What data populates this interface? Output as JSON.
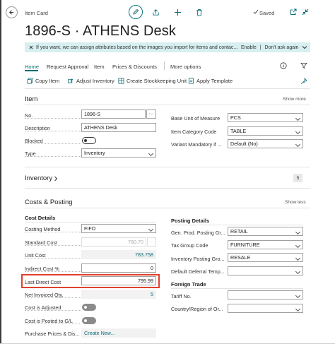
{
  "header": {
    "breadcrumb": "Item Card",
    "saved_label": "Saved",
    "title": "1896-S · ATHENS Desk"
  },
  "notification": {
    "message": "If you want, we can assign attributes based on the images you import for items and contac...",
    "enable_label": "Enable",
    "separator": "|",
    "dont_ask_label": "Don't ask again"
  },
  "tabs": {
    "home": "Home",
    "request_approval": "Request Approval",
    "item": "Item",
    "prices_discounts": "Prices & Discounts",
    "more_options": "More options"
  },
  "actions": {
    "copy_item": "Copy Item",
    "adjust_inventory": "Adjust Inventory",
    "create_sku": "Create Stockkeeping Unit",
    "apply_template": "Apply Template"
  },
  "item_section": {
    "title": "Item",
    "show_more": "Show more",
    "fields": {
      "no_label": "No.",
      "no_value": "1896-S",
      "description_label": "Description",
      "description_value": "ATHENS Desk",
      "blocked_label": "Blocked",
      "type_label": "Type",
      "type_value": "Inventory",
      "base_uom_label": "Base Unit of Measure",
      "base_uom_value": "PCS",
      "item_category_label": "Item Category Code",
      "item_category_value": "TABLE",
      "variant_mandatory_label": "Variant Mandatory if ...",
      "variant_mandatory_value": "Default (No)"
    }
  },
  "inventory_section": {
    "title": "Inventory",
    "badge": "5"
  },
  "costs_section": {
    "title": "Costs & Posting",
    "show_less": "Show less",
    "cost_details_heading": "Cost Details",
    "posting_details_heading": "Posting Details",
    "foreign_trade_heading": "Foreign Trade",
    "costing_method_label": "Costing Method",
    "costing_method_value": "FIFO",
    "standard_cost_label": "Standard Cost",
    "standard_cost_value": "780.70",
    "unit_cost_label": "Unit Cost",
    "unit_cost_value": "783.758",
    "indirect_cost_label": "Indirect Cost %",
    "indirect_cost_value": "0",
    "last_direct_cost_label": "Last Direct Cost",
    "last_direct_cost_value": "795.99",
    "net_invoiced_qty_label": "Net Invoiced Qty.",
    "net_invoiced_qty_value": "5",
    "cost_is_adjusted_label": "Cost is Adjusted",
    "cost_posted_gl_label": "Cost is Posted to G/L",
    "purchase_prices_label": "Purchase Prices & Dis...",
    "purchase_prices_value": "Create New...",
    "gen_prod_posting_label": "Gen. Prod. Posting Gr...",
    "gen_prod_posting_value": "RETAIL",
    "tax_group_label": "Tax Group Code",
    "tax_group_value": "FURNITURE",
    "inventory_posting_label": "Inventory Posting Gro...",
    "inventory_posting_value": "RESALE",
    "default_deferral_label": "Default Deferral Temp...",
    "default_deferral_value": "",
    "tariff_no_label": "Tariff No.",
    "tariff_no_value": "",
    "country_region_label": "Country/Region of Or...",
    "country_region_value": ""
  },
  "colors": {
    "accent": "#0a6c74",
    "notification_bg": "#d7eff0",
    "highlight_border": "#e0412c"
  }
}
